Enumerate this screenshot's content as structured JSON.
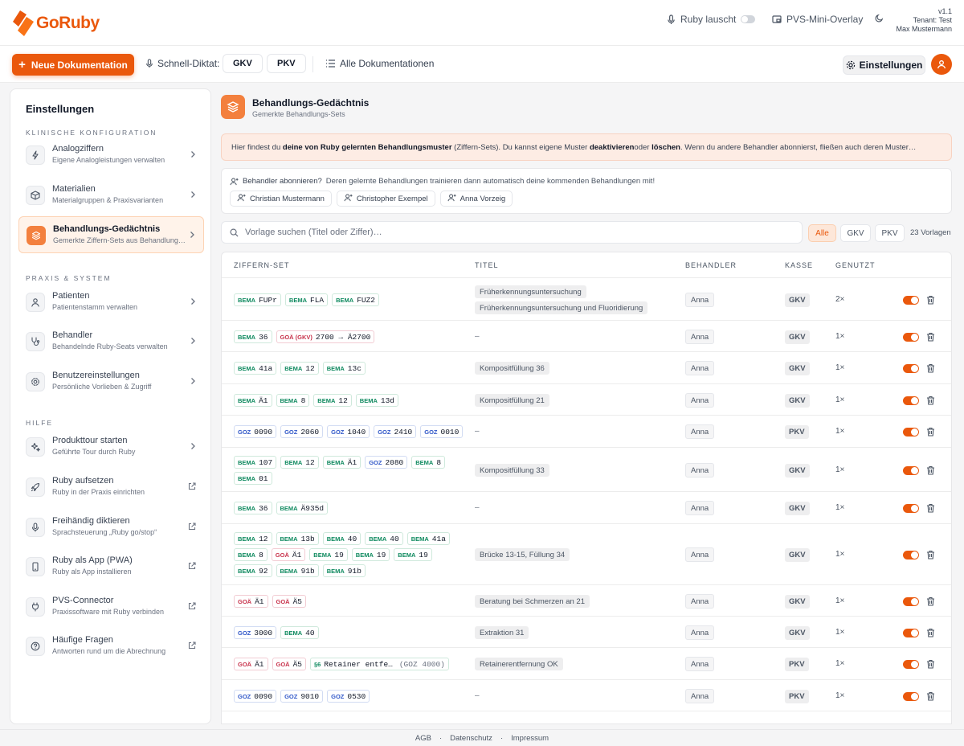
{
  "app": {
    "name": "GoRuby",
    "brand_color": "#ea580c"
  },
  "topbar": {
    "listen_label": "Ruby lauscht",
    "overlay_label": "PVS-Mini-Overlay",
    "version": "v1.1",
    "tenant": "Tenant: Test",
    "user": "Max Mustermann"
  },
  "toolbar": {
    "new_doc_label": "Neue Dokumentation",
    "quick_dictate_label": "Schnell-Diktat:",
    "gkv_label": "GKV",
    "pkv_label": "PKV",
    "all_docs_label": "Alle Dokumentationen",
    "settings_label": "Einstellungen"
  },
  "sidebar": {
    "title": "Einstellungen",
    "sections": [
      {
        "title": "KLINISCHE KONFIGURATION",
        "items": [
          {
            "label": "Analogziffern",
            "sub": "Eigene Analogleistungen verwalten",
            "icon": "bolt-icon",
            "trail": "chevron"
          },
          {
            "label": "Materialien",
            "sub": "Materialgruppen & Praxisvarianten",
            "icon": "box-icon",
            "trail": "chevron"
          },
          {
            "label": "Behandlungs-Gedächtnis",
            "sub": "Gemerkte Ziffern-Sets aus Behandlungen",
            "icon": "layers-icon",
            "trail": "chevron",
            "active": true
          }
        ]
      },
      {
        "title": "PRAXIS & SYSTEM",
        "items": [
          {
            "label": "Patienten",
            "sub": "Patientenstamm verwalten",
            "icon": "user-icon",
            "trail": "chevron"
          },
          {
            "label": "Behandler",
            "sub": "Behandelnde Ruby-Seats verwalten",
            "icon": "stethoscope-icon",
            "trail": "chevron"
          },
          {
            "label": "Benutzereinstellungen",
            "sub": "Persönliche Vorlieben & Zugriff",
            "icon": "gear-icon",
            "trail": "chevron"
          }
        ]
      },
      {
        "title": "HILFE",
        "items": [
          {
            "label": "Produkttour starten",
            "sub": "Geführte Tour durch Ruby",
            "icon": "sparkles-icon",
            "trail": "chevron"
          },
          {
            "label": "Ruby aufsetzen",
            "sub": "Ruby in der Praxis einrichten",
            "icon": "rocket-icon",
            "trail": "external"
          },
          {
            "label": "Freihändig diktieren",
            "sub": "Sprachsteuerung „Ruby go/stop“",
            "icon": "mic-icon",
            "trail": "external"
          },
          {
            "label": "Ruby als App (PWA)",
            "sub": "Ruby als App installieren",
            "icon": "phone-icon",
            "trail": "external"
          },
          {
            "label": "PVS-Connector",
            "sub": "Praxissoftware mit Ruby verbinden",
            "icon": "plug-icon",
            "trail": "external"
          },
          {
            "label": "Häufige Fragen",
            "sub": "Antworten rund um die Abrechnung",
            "icon": "question-icon",
            "trail": "external"
          }
        ]
      }
    ]
  },
  "page": {
    "title": "Behandlungs-Gedächtnis",
    "subtitle": "Gemerkte Behandlungs-Sets",
    "info_parts": [
      {
        "t": "Hier findest du ",
        "b": false
      },
      {
        "t": "deine von Ruby gelernten Behandlungsmuster",
        "b": true
      },
      {
        "t": " (Ziffern-Sets). Du kannst eigene Muster ",
        "b": false
      },
      {
        "t": "deaktivieren",
        "b": true
      },
      {
        "t": "oder ",
        "b": false
      },
      {
        "t": "löschen",
        "b": true
      },
      {
        "t": ". Wenn du andere Behandler abonnierst, fließen auch deren Muster…",
        "b": false
      }
    ],
    "subscribe_label": "Behandler abonnieren?",
    "subscribe_text": "Deren gelernte Behandlungen trainieren dann automatisch deine kommenden Behandlungen mit!",
    "subscribe_people": [
      "Christian Mustermann",
      "Christopher Exempel",
      "Anna Vorzeig"
    ],
    "search_placeholder": "Vorlage suchen (Titel oder Ziffer)…",
    "filters": [
      "Alle",
      "GKV",
      "PKV"
    ],
    "active_filter": "Alle",
    "count_label": "23 Vorlagen"
  },
  "table": {
    "headers": [
      "ZIFFERN-SET",
      "TITEL",
      "BEHANDLER",
      "KASSE",
      "GENUTZT"
    ],
    "rows": [
      {
        "codes": [
          [
            "BEMA",
            "FUPr"
          ],
          [
            "BEMA",
            "FLA"
          ],
          [
            "BEMA",
            "FUZ2"
          ]
        ],
        "titles": [
          "Früherkennungsuntersuchung",
          "Früherkennungsuntersuchung und Fluoridierung"
        ],
        "behandler": "Anna",
        "kasse": "GKV",
        "used": "2×",
        "active": true
      },
      {
        "codes": [
          [
            "BEMA",
            "36"
          ],
          [
            "GOÄ (GKV)",
            "2700 → Ä2700"
          ]
        ],
        "titles": [],
        "behandler": "Anna",
        "kasse": "GKV",
        "used": "1×",
        "active": true
      },
      {
        "codes": [
          [
            "BEMA",
            "41a"
          ],
          [
            "BEMA",
            "12"
          ],
          [
            "BEMA",
            "13c"
          ]
        ],
        "titles": [
          "Kompositfüllung 36"
        ],
        "behandler": "Anna",
        "kasse": "GKV",
        "used": "1×",
        "active": true
      },
      {
        "codes": [
          [
            "BEMA",
            "Ä1"
          ],
          [
            "BEMA",
            "8"
          ],
          [
            "BEMA",
            "12"
          ],
          [
            "BEMA",
            "13d"
          ]
        ],
        "titles": [
          "Kompositfüllung 21"
        ],
        "behandler": "Anna",
        "kasse": "GKV",
        "used": "1×",
        "active": true
      },
      {
        "codes": [
          [
            "GOZ",
            "0090"
          ],
          [
            "GOZ",
            "2060"
          ],
          [
            "GOZ",
            "1040"
          ],
          [
            "GOZ",
            "2410"
          ],
          [
            "GOZ",
            "0010"
          ]
        ],
        "titles": [],
        "behandler": "Anna",
        "kasse": "PKV",
        "used": "1×",
        "active": true
      },
      {
        "codes": [
          [
            "BEMA",
            "107"
          ],
          [
            "BEMA",
            "12"
          ],
          [
            "BEMA",
            "Ä1"
          ],
          [
            "GOZ",
            "2080"
          ],
          [
            "BEMA",
            "8"
          ],
          [
            "BEMA",
            "01"
          ]
        ],
        "titles": [
          "Kompositfüllung 33"
        ],
        "behandler": "Anna",
        "kasse": "GKV",
        "used": "1×",
        "active": true
      },
      {
        "codes": [
          [
            "BEMA",
            "36"
          ],
          [
            "BEMA",
            "Ä935d"
          ]
        ],
        "titles": [],
        "behandler": "Anna",
        "kasse": "GKV",
        "used": "1×",
        "active": true
      },
      {
        "codes": [
          [
            "BEMA",
            "12"
          ],
          [
            "BEMA",
            "13b"
          ],
          [
            "BEMA",
            "40"
          ],
          [
            "BEMA",
            "40"
          ],
          [
            "BEMA",
            "41a"
          ],
          [
            "BEMA",
            "8"
          ],
          [
            "GOÄ",
            "Ä1"
          ],
          [
            "BEMA",
            "19"
          ],
          [
            "BEMA",
            "19"
          ],
          [
            "BEMA",
            "19"
          ],
          [
            "BEMA",
            "92"
          ],
          [
            "BEMA",
            "91b"
          ],
          [
            "BEMA",
            "91b"
          ]
        ],
        "titles": [
          "Brücke 13-15, Füllung 34"
        ],
        "behandler": "Anna",
        "kasse": "GKV",
        "used": "1×",
        "active": true
      },
      {
        "codes": [
          [
            "GOÄ",
            "Ä1"
          ],
          [
            "GOÄ",
            "Ä5"
          ]
        ],
        "titles": [
          "Beratung bei Schmerzen an 21"
        ],
        "behandler": "Anna",
        "kasse": "GKV",
        "used": "1×",
        "active": true
      },
      {
        "codes": [
          [
            "GOZ",
            "3000"
          ],
          [
            "BEMA",
            "40"
          ]
        ],
        "titles": [
          "Extraktion 31"
        ],
        "behandler": "Anna",
        "kasse": "GKV",
        "used": "1×",
        "active": true
      },
      {
        "codes": [
          [
            "GOÄ",
            "Ä1"
          ],
          [
            "GOÄ",
            "Ä5"
          ],
          [
            "§6",
            "Retainer entfe…",
            "(GOZ 4000)"
          ]
        ],
        "titles": [
          "Retainerentfernung OK"
        ],
        "behandler": "Anna",
        "kasse": "PKV",
        "used": "1×",
        "active": true
      },
      {
        "codes": [
          [
            "GOZ",
            "0090"
          ],
          [
            "GOZ",
            "9010"
          ],
          [
            "GOZ",
            "0530"
          ]
        ],
        "titles": [],
        "behandler": "Anna",
        "kasse": "PKV",
        "used": "1×",
        "active": true
      }
    ],
    "empty_title": "–"
  },
  "footer": {
    "links": [
      "AGB",
      "Datenschutz",
      "Impressum"
    ],
    "sep": "·"
  }
}
